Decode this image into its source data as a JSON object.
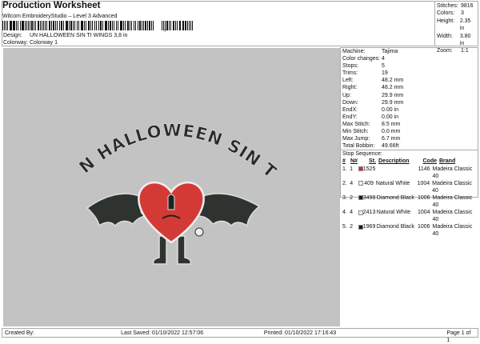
{
  "header": {
    "title": "Production Worksheet",
    "subtitle": "Wilcom EmbroideryStudio – Level 3 Advanced",
    "barcode_suffix": ",",
    "design_label": "Design:",
    "design_value": "UN HALLOWEEN SIN TI WINGS 3,8 in",
    "colorway_label": "Colorway:",
    "colorway_value": "Colorway 1"
  },
  "stats": [
    {
      "k": "Stitches:",
      "v": "9816"
    },
    {
      "k": "Colors:",
      "v": "3"
    },
    {
      "k": "Height:",
      "v": "2.35 in"
    },
    {
      "k": "Width:",
      "v": "3.80 in"
    },
    {
      "k": "Zoom:",
      "v": "1:1"
    }
  ],
  "design": {
    "text": "UN HALLOWEEN SIN TI"
  },
  "info": [
    {
      "k": "Machine:",
      "v": "Tajima"
    },
    {
      "k": "Color changes:",
      "v": "4"
    },
    {
      "k": "Stops:",
      "v": "5"
    },
    {
      "k": "Trims:",
      "v": "19"
    },
    {
      "k": "Left:",
      "v": "48.2 mm"
    },
    {
      "k": "Right:",
      "v": "48.2 mm"
    },
    {
      "k": "Up:",
      "v": "29.9 mm"
    },
    {
      "k": "Down:",
      "v": "29.9 mm"
    },
    {
      "k": "EndX:",
      "v": "0.00 in"
    },
    {
      "k": "EndY:",
      "v": "0.00 in"
    },
    {
      "k": "Max Stitch:",
      "v": "8.5 mm"
    },
    {
      "k": "Min Stitch:",
      "v": "0.0 mm"
    },
    {
      "k": "Max Jump:",
      "v": "6.7 mm"
    },
    {
      "k": "Total Bobbin:",
      "v": "49.66ft"
    }
  ],
  "stop_sequence": {
    "label": "Stop Sequence:",
    "headers": [
      "#",
      "N#",
      "St.",
      "Description",
      "Code",
      "Brand"
    ],
    "rows": [
      {
        "n": "1.",
        "needle": "1",
        "color": "#d42a2a",
        "st": "1525",
        "desc": "",
        "code": "1146",
        "brand": "Madeira Classic 40"
      },
      {
        "n": "2.",
        "needle": "4",
        "color": "#f0f0f0",
        "st": "409",
        "desc": "Natural White",
        "code": "1004",
        "brand": "Madeira Classic 40"
      },
      {
        "n": "3.",
        "needle": "2",
        "color": "#1a1a1a",
        "st": "3498",
        "desc": "Diamond Black",
        "code": "1006",
        "brand": "Madeira Classic 40"
      },
      {
        "n": "4.",
        "needle": "4",
        "color": "#f0f0f0",
        "st": "2413",
        "desc": "Natural White",
        "code": "1004",
        "brand": "Madeira Classic 40"
      },
      {
        "n": "5.",
        "needle": "2",
        "color": "#1a1a1a",
        "st": "1969",
        "desc": "Diamond Black",
        "code": "1006",
        "brand": "Madeira Classic 40"
      }
    ]
  },
  "footer": {
    "created": "Created By:",
    "saved": "Last Saved: 01/10/2022 12:57:06",
    "printed": "Printed: 01/10/2022 17:16:43",
    "page": "Page 1 of 1"
  }
}
